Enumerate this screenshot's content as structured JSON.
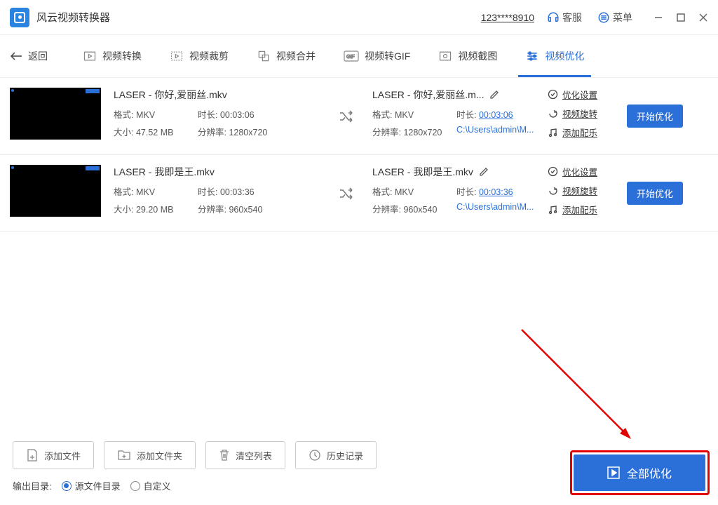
{
  "header": {
    "app_title": "风云视频转换器",
    "user_id": "123****8910",
    "support": "客服",
    "menu": "菜单"
  },
  "toolbar": {
    "back": "返回",
    "tabs": {
      "convert": "视频转换",
      "crop": "视频裁剪",
      "merge": "视频合并",
      "gif": "视频转GIF",
      "screenshot": "视频截图",
      "optimize": "视频优化"
    }
  },
  "files": [
    {
      "name": "LASER - 你好,爱丽丝.mkv",
      "format_label": "格式:",
      "format": "MKV",
      "duration_label": "时长:",
      "duration": "00:03:06",
      "size_label": "大小:",
      "size": "47.52 MB",
      "res_label": "分辨率:",
      "res": "1280x720",
      "out_name": "LASER - 你好,爱丽丝.m...",
      "out_format": "MKV",
      "out_duration": "00:03:06",
      "out_res": "1280x720",
      "out_path": "C:\\Users\\admin\\M..."
    },
    {
      "name": "LASER - 我即是王.mkv",
      "format_label": "格式:",
      "format": "MKV",
      "duration_label": "时长:",
      "duration": "00:03:36",
      "size_label": "大小:",
      "size": "29.20 MB",
      "res_label": "分辨率:",
      "res": "960x540",
      "out_name": "LASER - 我即是王.mkv",
      "out_format": "MKV",
      "out_duration": "00:03:36",
      "out_res": "960x540",
      "out_path": "C:\\Users\\admin\\M..."
    }
  ],
  "options": {
    "settings": "优化设置",
    "rotate": "视频旋转",
    "music": "添加配乐"
  },
  "buttons": {
    "start": "开始优化",
    "add_file": "添加文件",
    "add_folder": "添加文件夹",
    "clear": "清空列表",
    "history": "历史记录",
    "optimize_all": "全部优化"
  },
  "output": {
    "label": "输出目录:",
    "source": "源文件目录",
    "custom": "自定义"
  }
}
